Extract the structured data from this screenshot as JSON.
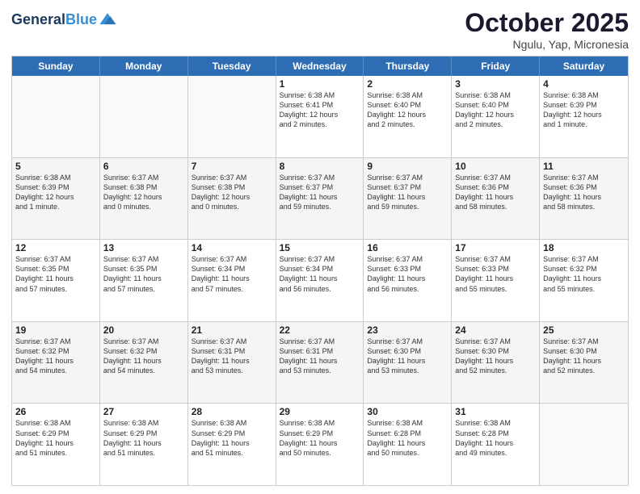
{
  "header": {
    "logo_line1": "General",
    "logo_line2": "Blue",
    "month": "October 2025",
    "location": "Ngulu, Yap, Micronesia"
  },
  "day_headers": [
    "Sunday",
    "Monday",
    "Tuesday",
    "Wednesday",
    "Thursday",
    "Friday",
    "Saturday"
  ],
  "weeks": [
    [
      {
        "num": "",
        "info": ""
      },
      {
        "num": "",
        "info": ""
      },
      {
        "num": "",
        "info": ""
      },
      {
        "num": "1",
        "info": "Sunrise: 6:38 AM\nSunset: 6:41 PM\nDaylight: 12 hours\nand 2 minutes."
      },
      {
        "num": "2",
        "info": "Sunrise: 6:38 AM\nSunset: 6:40 PM\nDaylight: 12 hours\nand 2 minutes."
      },
      {
        "num": "3",
        "info": "Sunrise: 6:38 AM\nSunset: 6:40 PM\nDaylight: 12 hours\nand 2 minutes."
      },
      {
        "num": "4",
        "info": "Sunrise: 6:38 AM\nSunset: 6:39 PM\nDaylight: 12 hours\nand 1 minute."
      }
    ],
    [
      {
        "num": "5",
        "info": "Sunrise: 6:38 AM\nSunset: 6:39 PM\nDaylight: 12 hours\nand 1 minute."
      },
      {
        "num": "6",
        "info": "Sunrise: 6:37 AM\nSunset: 6:38 PM\nDaylight: 12 hours\nand 0 minutes."
      },
      {
        "num": "7",
        "info": "Sunrise: 6:37 AM\nSunset: 6:38 PM\nDaylight: 12 hours\nand 0 minutes."
      },
      {
        "num": "8",
        "info": "Sunrise: 6:37 AM\nSunset: 6:37 PM\nDaylight: 11 hours\nand 59 minutes."
      },
      {
        "num": "9",
        "info": "Sunrise: 6:37 AM\nSunset: 6:37 PM\nDaylight: 11 hours\nand 59 minutes."
      },
      {
        "num": "10",
        "info": "Sunrise: 6:37 AM\nSunset: 6:36 PM\nDaylight: 11 hours\nand 58 minutes."
      },
      {
        "num": "11",
        "info": "Sunrise: 6:37 AM\nSunset: 6:36 PM\nDaylight: 11 hours\nand 58 minutes."
      }
    ],
    [
      {
        "num": "12",
        "info": "Sunrise: 6:37 AM\nSunset: 6:35 PM\nDaylight: 11 hours\nand 57 minutes."
      },
      {
        "num": "13",
        "info": "Sunrise: 6:37 AM\nSunset: 6:35 PM\nDaylight: 11 hours\nand 57 minutes."
      },
      {
        "num": "14",
        "info": "Sunrise: 6:37 AM\nSunset: 6:34 PM\nDaylight: 11 hours\nand 57 minutes."
      },
      {
        "num": "15",
        "info": "Sunrise: 6:37 AM\nSunset: 6:34 PM\nDaylight: 11 hours\nand 56 minutes."
      },
      {
        "num": "16",
        "info": "Sunrise: 6:37 AM\nSunset: 6:33 PM\nDaylight: 11 hours\nand 56 minutes."
      },
      {
        "num": "17",
        "info": "Sunrise: 6:37 AM\nSunset: 6:33 PM\nDaylight: 11 hours\nand 55 minutes."
      },
      {
        "num": "18",
        "info": "Sunrise: 6:37 AM\nSunset: 6:32 PM\nDaylight: 11 hours\nand 55 minutes."
      }
    ],
    [
      {
        "num": "19",
        "info": "Sunrise: 6:37 AM\nSunset: 6:32 PM\nDaylight: 11 hours\nand 54 minutes."
      },
      {
        "num": "20",
        "info": "Sunrise: 6:37 AM\nSunset: 6:32 PM\nDaylight: 11 hours\nand 54 minutes."
      },
      {
        "num": "21",
        "info": "Sunrise: 6:37 AM\nSunset: 6:31 PM\nDaylight: 11 hours\nand 53 minutes."
      },
      {
        "num": "22",
        "info": "Sunrise: 6:37 AM\nSunset: 6:31 PM\nDaylight: 11 hours\nand 53 minutes."
      },
      {
        "num": "23",
        "info": "Sunrise: 6:37 AM\nSunset: 6:30 PM\nDaylight: 11 hours\nand 53 minutes."
      },
      {
        "num": "24",
        "info": "Sunrise: 6:37 AM\nSunset: 6:30 PM\nDaylight: 11 hours\nand 52 minutes."
      },
      {
        "num": "25",
        "info": "Sunrise: 6:37 AM\nSunset: 6:30 PM\nDaylight: 11 hours\nand 52 minutes."
      }
    ],
    [
      {
        "num": "26",
        "info": "Sunrise: 6:38 AM\nSunset: 6:29 PM\nDaylight: 11 hours\nand 51 minutes."
      },
      {
        "num": "27",
        "info": "Sunrise: 6:38 AM\nSunset: 6:29 PM\nDaylight: 11 hours\nand 51 minutes."
      },
      {
        "num": "28",
        "info": "Sunrise: 6:38 AM\nSunset: 6:29 PM\nDaylight: 11 hours\nand 51 minutes."
      },
      {
        "num": "29",
        "info": "Sunrise: 6:38 AM\nSunset: 6:29 PM\nDaylight: 11 hours\nand 50 minutes."
      },
      {
        "num": "30",
        "info": "Sunrise: 6:38 AM\nSunset: 6:28 PM\nDaylight: 11 hours\nand 50 minutes."
      },
      {
        "num": "31",
        "info": "Sunrise: 6:38 AM\nSunset: 6:28 PM\nDaylight: 11 hours\nand 49 minutes."
      },
      {
        "num": "",
        "info": ""
      }
    ]
  ]
}
